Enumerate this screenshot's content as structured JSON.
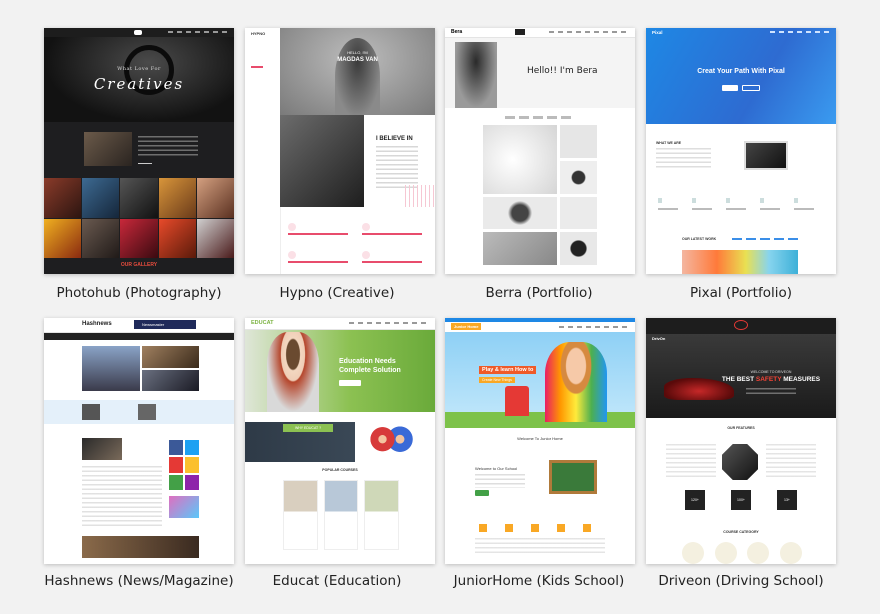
{
  "templates": [
    {
      "caption": "Photohub (Photography)",
      "hero_small": "What Love For",
      "hero_big": "Creatives",
      "section_label": "OUR GALLERY"
    },
    {
      "caption": "Hypno  (Creative)",
      "logo": "HYPNO",
      "hello": "HELLO, I'M",
      "name": "MAGDAS VAN",
      "believe": "I BELIEVE IN"
    },
    {
      "caption": "Berra  (Portfolio)",
      "logo": "Bera",
      "hero": "Hello!! I'm Bera"
    },
    {
      "caption": "Pixal  (Portfolio)",
      "logo": "Pixal",
      "hero": "Creat Your Path With Pixal",
      "what_we_are": "WHAT WE ARE",
      "latest_work": "OUR LATEST WORK"
    },
    {
      "caption": "Hashnews (News/Magazine)",
      "logo": "Hashnews",
      "banner": "Newsmaster"
    },
    {
      "caption": "Educat  (Education)",
      "logo": "EDUCAT",
      "hero_line1": "Education Needs",
      "hero_line2": "Complete Solution",
      "why": "WHY EDUCAT ?",
      "popular": "POPULAR COURSES"
    },
    {
      "caption": "JuniorHome (Kids School)",
      "logo": "Junior Home",
      "hero_line1": "Play & learn How to",
      "hero_line2": "Create New Things",
      "welcome": "Welcome To Junior Home",
      "school": "Welcome to Our School"
    },
    {
      "caption": "Driveon (Driving School)",
      "logo": "DrivOn",
      "hero_small": "WELCOME TO DRIVEON",
      "hero_prefix": "THE BEST",
      "hero_accent": "SAFETY",
      "hero_suffix": "MEASURES",
      "features": "OUR FEATURES",
      "category": "COURSE CATEGORY",
      "stats": [
        "120+",
        "100+",
        "13+"
      ]
    }
  ]
}
